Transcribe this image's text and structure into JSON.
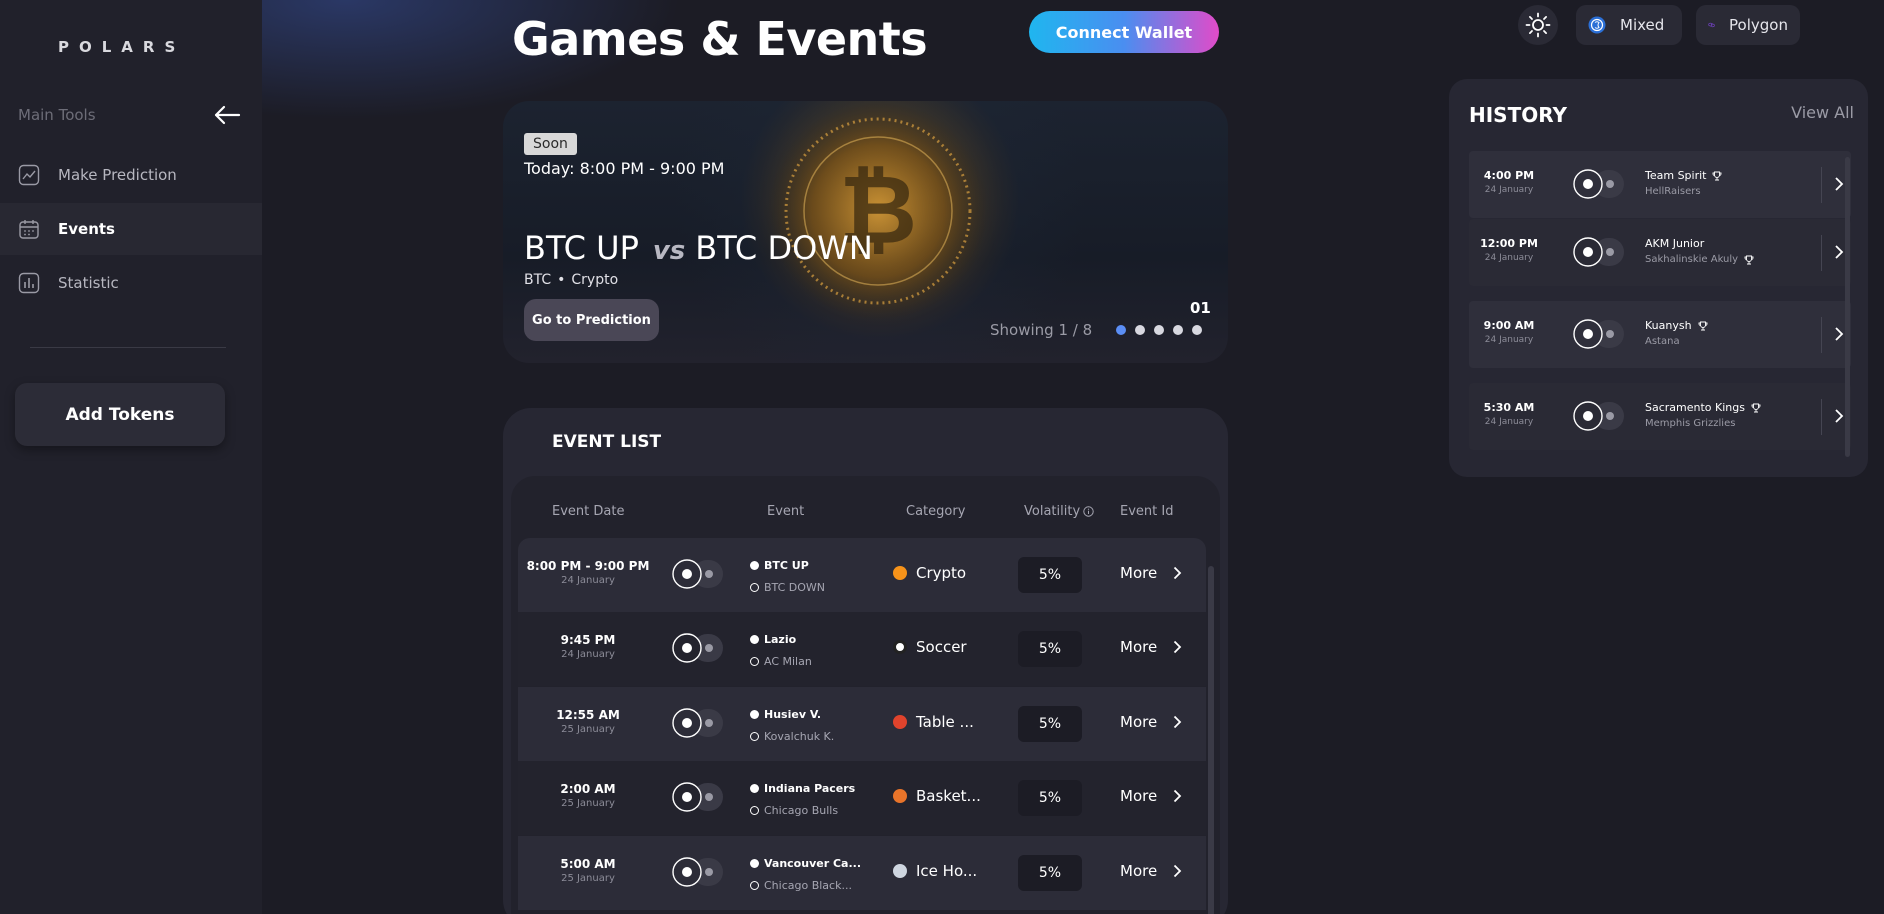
{
  "sidebar": {
    "logo": "POLARS",
    "section_label": "Main Tools",
    "items": [
      {
        "label": "Make Prediction",
        "icon": "chart-line-icon",
        "active": false
      },
      {
        "label": "Events",
        "icon": "calendar-icon",
        "active": true
      },
      {
        "label": "Statistic",
        "icon": "bar-chart-icon",
        "active": false
      }
    ],
    "add_tokens_label": "Add Tokens"
  },
  "header": {
    "title": "Games & Events",
    "connect_wallet_label": "Connect Wallet",
    "mode_label": "Mixed",
    "network_label": "Polygon"
  },
  "hero": {
    "badge": "Soon",
    "time": "Today: 8:00 PM - 9:00 PM",
    "team_a": "BTC UP",
    "vs": "vs",
    "team_b": "BTC DOWN",
    "asset": "BTC",
    "bullet": "•",
    "category": "Crypto",
    "button_label": "Go to Prediction",
    "slide_number": "01",
    "showing": "Showing 1 / 8",
    "active_dot": 0,
    "dot_count": 5
  },
  "event_list": {
    "title": "EVENT LIST",
    "columns": [
      "Event Date",
      "Event",
      "Category",
      "Volatility",
      "Event Id"
    ],
    "rows": [
      {
        "time": "8:00 PM - 9:00 PM",
        "date": "24 January",
        "team_a": "BTC UP",
        "team_b": "BTC DOWN",
        "category": "Crypto",
        "category_color": "#f7931a",
        "volatility": "5%",
        "more": "More"
      },
      {
        "time": "9:45 PM",
        "date": "24 January",
        "team_a": "Lazio",
        "team_b": "AC Milan",
        "category": "Soccer",
        "category_color": "#ffffff",
        "volatility": "5%",
        "more": "More"
      },
      {
        "time": "12:55 AM",
        "date": "25 January",
        "team_a": "Husiev V.",
        "team_b": "Kovalchuk K.",
        "category": "Table ...",
        "category_color": "#e0432c",
        "volatility": "5%",
        "more": "More"
      },
      {
        "time": "2:00 AM",
        "date": "25 January",
        "team_a": "Indiana Pacers",
        "team_b": "Chicago Bulls",
        "category": "Basket...",
        "category_color": "#e8742a",
        "volatility": "5%",
        "more": "More"
      },
      {
        "time": "5:00 AM",
        "date": "25 January",
        "team_a": "Vancouver Ca...",
        "team_b": "Chicago Black...",
        "category": "Ice Ho...",
        "category_color": "#cfd6e0",
        "volatility": "5%",
        "more": "More"
      }
    ]
  },
  "history": {
    "title": "HISTORY",
    "view_all": "View All",
    "rows": [
      {
        "time": "4:00 PM",
        "date": "24 January",
        "team_a": "Team Spirit",
        "team_b": "HellRaisers",
        "winner": "a"
      },
      {
        "time": "12:00 PM",
        "date": "24 January",
        "team_a": "AKM Junior",
        "team_b": "Sakhalinskie Akuly",
        "winner": "b"
      },
      {
        "time": "9:00 AM",
        "date": "24 January",
        "team_a": "Kuanysh",
        "team_b": "Astana",
        "winner": "a"
      },
      {
        "time": "5:30 AM",
        "date": "24 January",
        "team_a": "Sacramento Kings",
        "team_b": "Memphis Grizzlies",
        "winner": "a"
      }
    ]
  },
  "colors": {
    "accent_blue": "#5b8ef5",
    "wallet_gradient_start": "#1fb6ef",
    "wallet_gradient_end": "#e14bc9",
    "background": "#1c1c25",
    "sidebar": "#21212b"
  }
}
